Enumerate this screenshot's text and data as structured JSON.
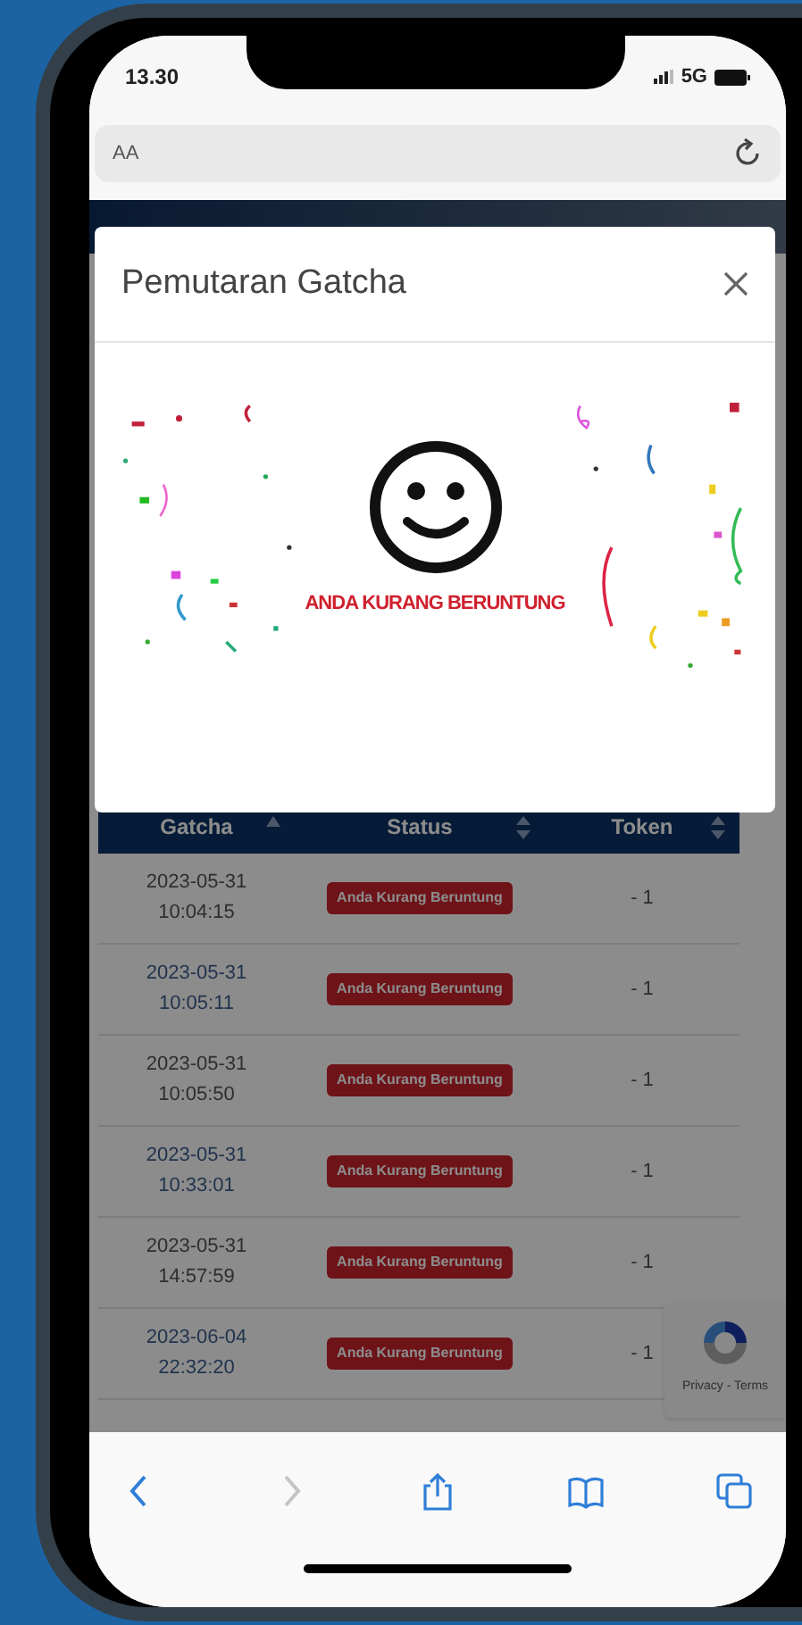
{
  "status_bar": {
    "time": "13.30",
    "network": "5G"
  },
  "address_bar": {
    "text_size_button": "AA"
  },
  "modal": {
    "title": "Pemutaran Gatcha",
    "result": "ANDA KURANG BERUNTUNG"
  },
  "table": {
    "columns": [
      {
        "label": "Gatcha",
        "sorted": true
      },
      {
        "label": "Status",
        "sorted": false
      },
      {
        "label": "Token",
        "sorted": false
      }
    ],
    "rows": [
      {
        "date": "2023-05-31 10:04:15",
        "status": "Anda Kurang Beruntung",
        "tokens": "- 1"
      },
      {
        "date": "2023-05-31 10:05:11",
        "status": "Anda Kurang Beruntung",
        "tokens": "- 1"
      },
      {
        "date": "2023-05-31 10:05:50",
        "status": "Anda Kurang Beruntung",
        "tokens": "- 1"
      },
      {
        "date": "2023-05-31 10:33:01",
        "status": "Anda Kurang Beruntung",
        "tokens": "- 1"
      },
      {
        "date": "2023-05-31 14:57:59",
        "status": "Anda Kurang Beruntung",
        "tokens": "- 1"
      },
      {
        "date": "2023-06-04 22:32:20",
        "status": "Anda Kurang Beruntung",
        "tokens": "- 1"
      }
    ]
  },
  "recaptcha": {
    "links": "Privacy - Terms"
  },
  "toolbar": [
    {
      "kind": "back",
      "disabled": false
    },
    {
      "kind": "forward",
      "disabled": true
    },
    {
      "kind": "share",
      "disabled": false
    },
    {
      "kind": "bookmarks",
      "disabled": false
    },
    {
      "kind": "tabs",
      "disabled": false
    }
  ]
}
